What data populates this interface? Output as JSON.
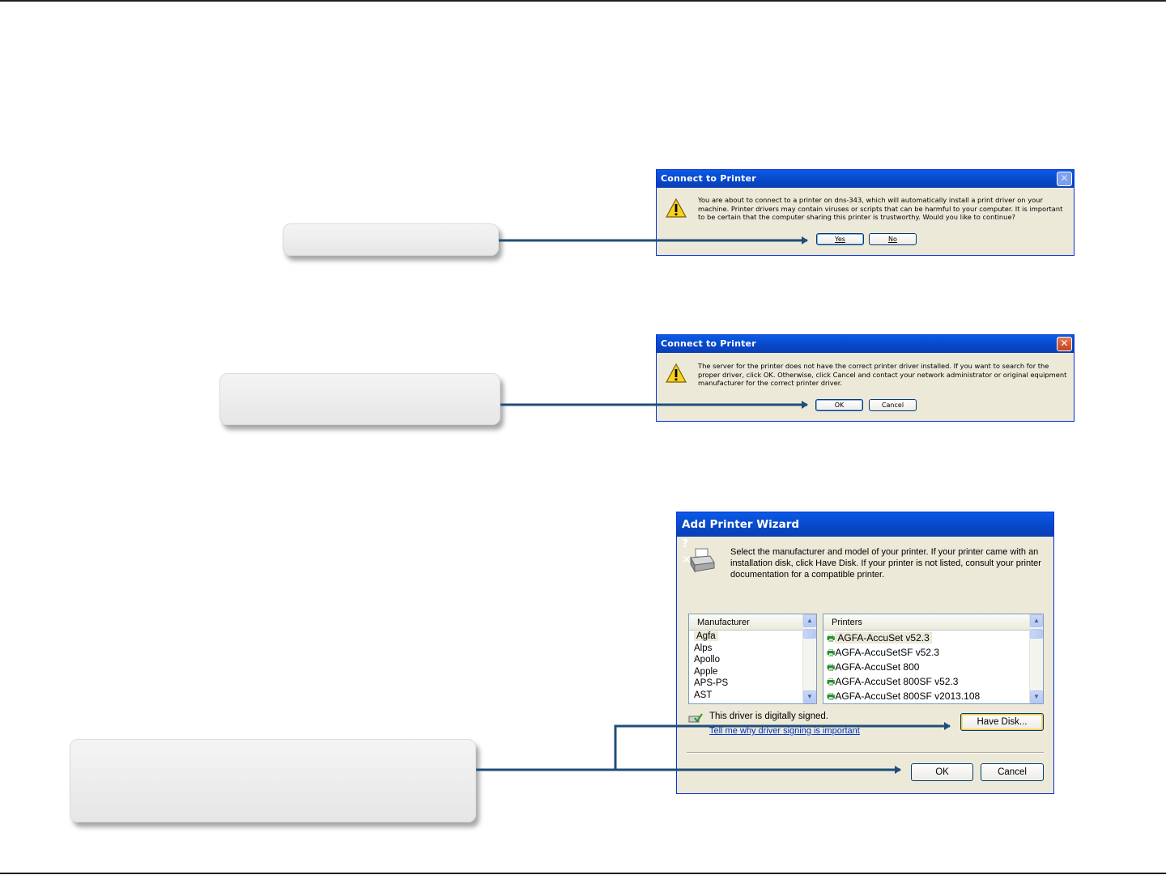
{
  "dialog_connect": {
    "title": "Connect to Printer",
    "message": "You are about to connect to a printer on dns-343, which will automatically install a print driver on your machine. Printer drivers may contain viruses or scripts that can be harmful to your computer.  It is important to be certain that the computer sharing this printer is trustworthy.  Would you like to continue?",
    "yes_label": "Yes",
    "no_label": "No"
  },
  "dialog_driver": {
    "title": "Connect to Printer",
    "message": "The server for the printer does not have the correct printer driver installed.  If you want to search for the proper driver, click OK.  Otherwise, click Cancel and contact your network administrator or original equipment manufacturer for the correct printer driver.",
    "ok_label": "OK",
    "cancel_label": "Cancel"
  },
  "wizard": {
    "title": "Add Printer Wizard",
    "intro": "Select the manufacturer and model of your printer. If your printer came with an installation disk, click Have Disk. If your printer is not listed, consult your printer documentation for a compatible printer.",
    "manufacturer_header": "Manufacturer",
    "manufacturers": [
      "Agfa",
      "Alps",
      "Apollo",
      "Apple",
      "APS-PS",
      "AST"
    ],
    "printers_header": "Printers",
    "printers": [
      "AGFA-AccuSet v52.3",
      "AGFA-AccuSetSF v52.3",
      "AGFA-AccuSet 800",
      "AGFA-AccuSet 800SF v52.3",
      "AGFA-AccuSet 800SF v2013.108"
    ],
    "signed_text": "This driver is digitally signed.",
    "signing_link": "Tell me why driver signing is important",
    "have_disk_label": "Have Disk...",
    "ok_label": "OK",
    "cancel_label": "Cancel"
  },
  "colors": {
    "connector": "#1f4e79",
    "xp_titlebar": "#0847c6"
  }
}
